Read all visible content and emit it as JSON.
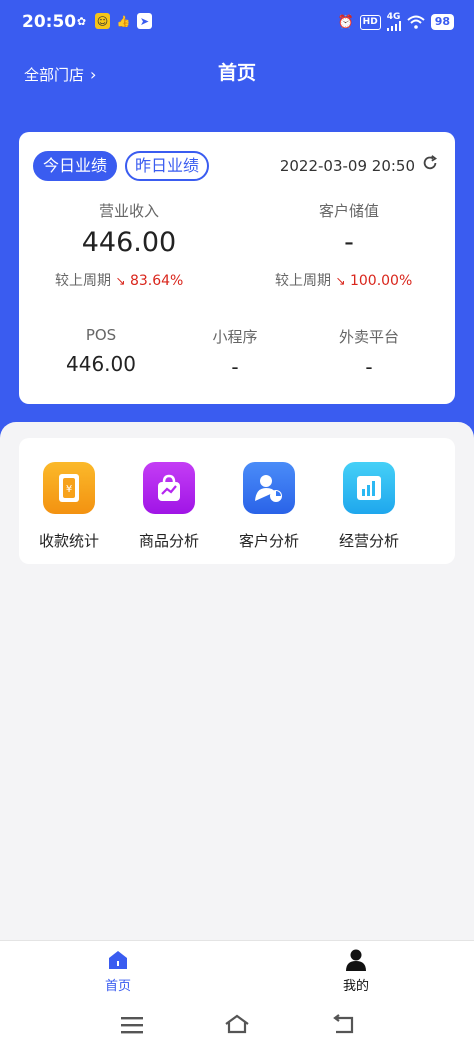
{
  "status_bar": {
    "time": "20:50",
    "hd": "HD",
    "network": "4G",
    "battery": "98"
  },
  "header": {
    "store_selector": "全部门店",
    "store_chevron": "›",
    "title": "首页"
  },
  "performance": {
    "tabs": [
      {
        "label": "今日业绩",
        "active": true
      },
      {
        "label": "昨日业绩",
        "active": false
      }
    ],
    "datetime": "2022-03-09 20:50",
    "revenue": {
      "label": "营业收入",
      "value": "446.00",
      "compare_label": "较上周期",
      "compare_value": "83.64%",
      "trend": "down"
    },
    "stored_value": {
      "label": "客户储值",
      "value": "-",
      "compare_label": "较上周期",
      "compare_value": "100.00%",
      "trend": "down"
    },
    "channels": [
      {
        "label": "POS",
        "value": "446.00"
      },
      {
        "label": "小程序",
        "value": "-"
      },
      {
        "label": "外卖平台",
        "value": "-"
      }
    ]
  },
  "features": [
    {
      "label": "收款统计",
      "icon": "payment-stats-icon",
      "color": "#f7a21b"
    },
    {
      "label": "商品分析",
      "icon": "product-analysis-icon",
      "color": "#b526f0"
    },
    {
      "label": "客户分析",
      "icon": "customer-analysis-icon",
      "color": "#3478f6"
    },
    {
      "label": "经营分析",
      "icon": "business-analysis-icon",
      "color": "#2bb8f2"
    }
  ],
  "bottom_nav": [
    {
      "label": "首页",
      "icon": "home-icon",
      "active": true
    },
    {
      "label": "我的",
      "icon": "profile-icon",
      "active": false
    }
  ],
  "colors": {
    "primary": "#3a5cf0",
    "down": "#d9261c"
  }
}
